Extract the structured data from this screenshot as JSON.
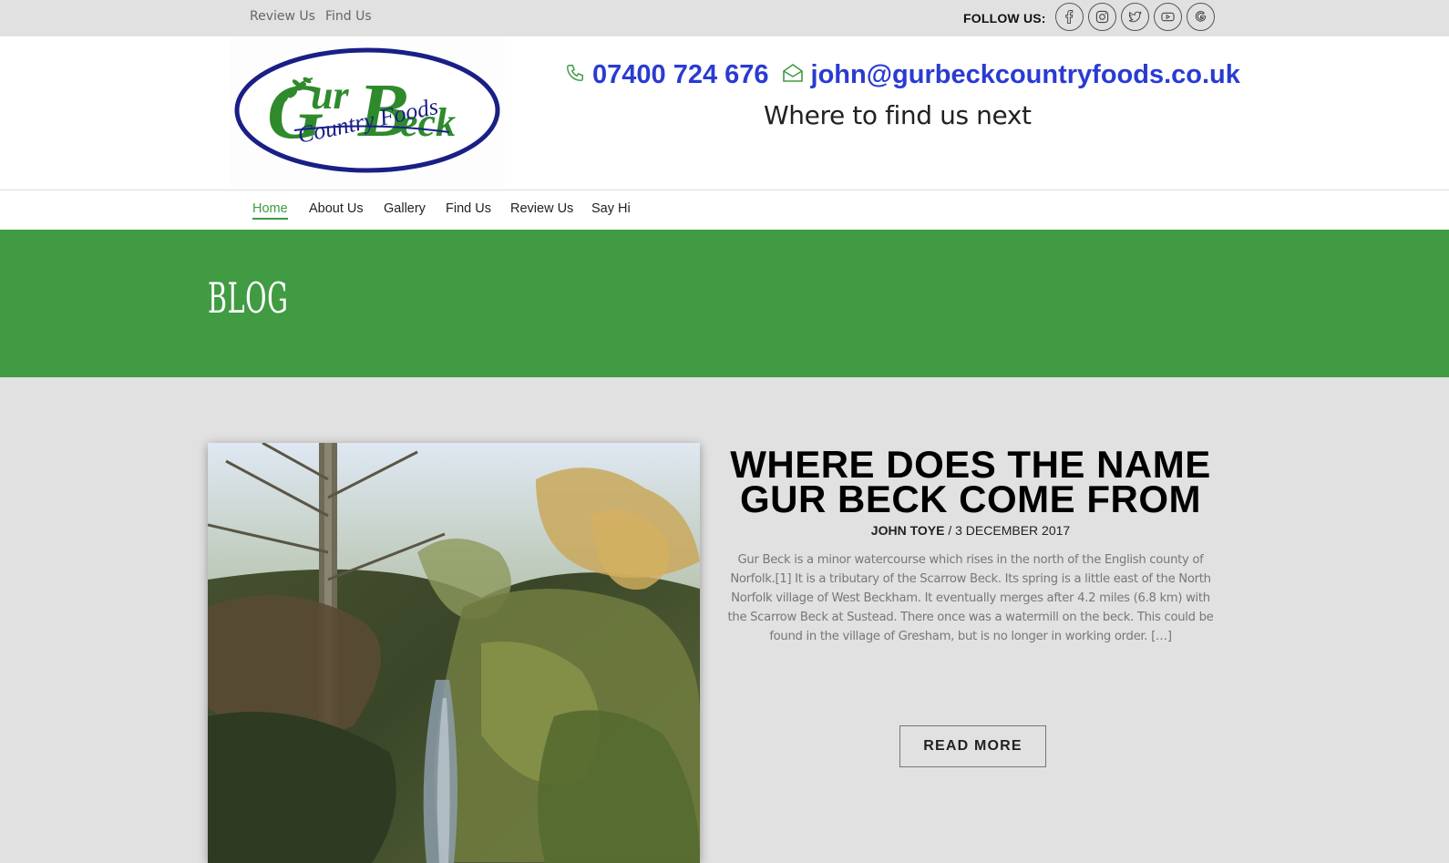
{
  "topbar": {
    "links": [
      "Review Us",
      "Find Us"
    ],
    "follow_label": "FOLLOW US:",
    "social_icons": [
      "facebook-icon",
      "instagram-icon",
      "twitter-icon",
      "youtube-icon",
      "google-icon"
    ]
  },
  "header": {
    "logo_text": [
      "Gur",
      "Beck",
      "Country Foods"
    ],
    "phone": "07400 724 676",
    "email": "john@gurbeckcountryfoods.co.uk",
    "tagline": "Where to find us next"
  },
  "nav": {
    "items": [
      "Home",
      "About Us",
      "Gallery",
      "Find Us",
      "Review Us",
      "Say Hi"
    ],
    "active": "Home"
  },
  "hero": {
    "title": "BLOG"
  },
  "post": {
    "title_line1": "WHERE DOES THE NAME",
    "title_line2": "GUR BECK COME FROM",
    "author": "JOHN TOYE",
    "separator": " / ",
    "date": "3 DECEMBER 2017",
    "excerpt": "Gur Beck is a minor watercourse which rises in the north of the English county of Norfolk.[1] It is a tributary of the Scarrow Beck. Its spring is a little east of the North Norfolk village of West Beckham. It eventually merges after 4.2 miles (6.8 km) with the Scarrow Beck at Sustead. There once was a watermill on the beck. This could be found in the village of Gresham, but is no longer in working order. […]",
    "read_more": "READ MORE"
  },
  "colors": {
    "brand_green": "#409b43",
    "link_blue": "#2a3bd2",
    "logo_navy": "#1a1f86",
    "logo_green": "#2f8a2c"
  }
}
